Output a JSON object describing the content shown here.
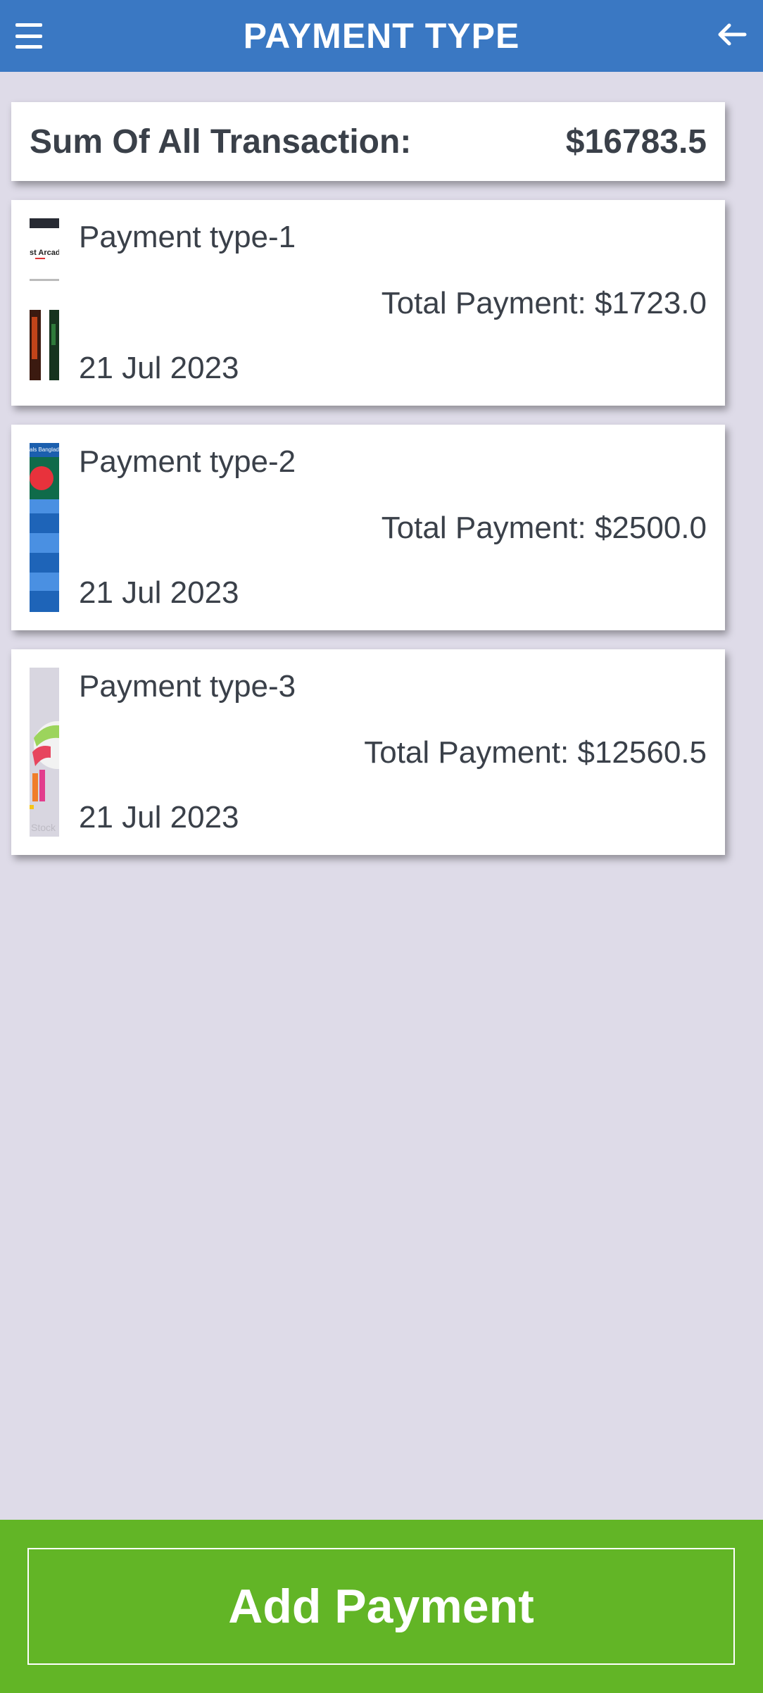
{
  "header": {
    "title": "PAYMENT TYPE",
    "menu_icon": "menu-icon",
    "back_icon": "arrow-left-icon",
    "bg_color": "#3a78c3"
  },
  "summary": {
    "label": "Sum Of All Transaction:",
    "value": "$16783.5"
  },
  "payments": [
    {
      "name": "Payment type-1",
      "total": "Total Payment: $1723.0",
      "date": "21 Jul 2023",
      "thumb_text": "st Arcadia"
    },
    {
      "name": "Payment type-2",
      "total": "Total Payment: $2500.0",
      "date": "21 Jul 2023",
      "thumb_text": "als Banglade"
    },
    {
      "name": "Payment type-3",
      "total": "Total Payment: $12560.5",
      "date": "21 Jul 2023",
      "thumb_text": "Stock"
    }
  ],
  "footer": {
    "button_label": "Add Payment",
    "bg_color": "#62b526"
  }
}
